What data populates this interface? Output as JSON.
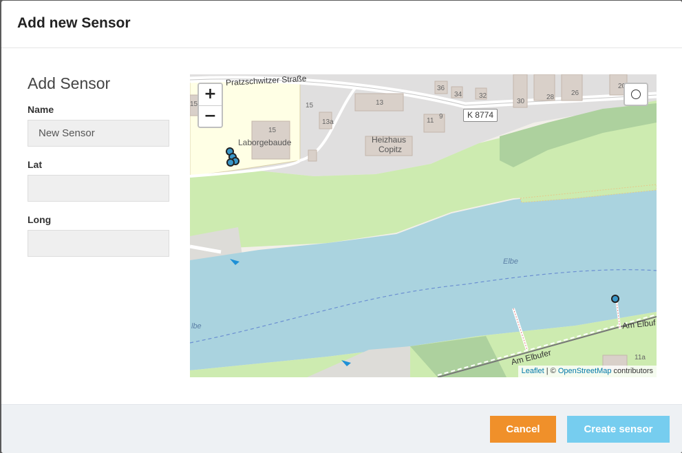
{
  "modal": {
    "title": "Add new Sensor"
  },
  "form": {
    "heading": "Add Sensor",
    "name_label": "Name",
    "name_value": "New Sensor",
    "lat_label": "Lat",
    "lat_value": "",
    "long_label": "Long",
    "long_value": ""
  },
  "map": {
    "zoom_in": "+",
    "zoom_out": "−",
    "draw_circle_icon": "circle-icon",
    "street_top": "Pratzschwitzer Straße",
    "building_laborgebaude": "Laborgebaude",
    "building_heizhaus_1": "Heizhaus",
    "building_heizhaus_2": "Copitz",
    "road_badge": "K 8774",
    "river_label": "Elbe",
    "river_label_2": "lbe",
    "street_bottom": "Am Elbufer",
    "street_bottom_right": "Am Elbuf",
    "house_numbers": [
      "15",
      "15",
      "15",
      "13",
      "13a",
      "11",
      "9",
      "36",
      "34",
      "32",
      "30",
      "28",
      "26",
      "20",
      "11a"
    ],
    "attribution_leaflet": "Leaflet",
    "attribution_sep": " | © ",
    "attribution_osm": "OpenStreetMap",
    "attribution_contrib": " contributors",
    "colors": {
      "water": "#aad3df",
      "grass": "#cdebb0",
      "building": "#d9d0c9",
      "residential": "#e0dfdf",
      "school": "#ffffe5",
      "marker": "#3a97c8"
    }
  },
  "footer": {
    "cancel_label": "Cancel",
    "create_label": "Create sensor",
    "cancel_color": "#f0902a",
    "create_color": "#76cdef"
  }
}
